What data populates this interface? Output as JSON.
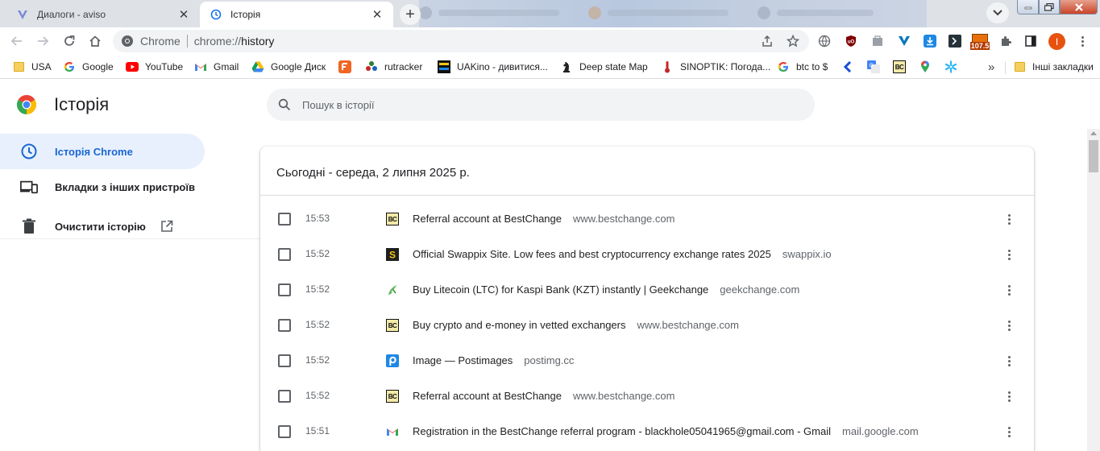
{
  "tabs": [
    {
      "title": "Диалоги - aviso",
      "state": "inactive"
    },
    {
      "title": "Історія",
      "state": "active"
    }
  ],
  "omnibox": {
    "site_label": "Chrome",
    "url_scheme": "chrome://",
    "url_path": "history"
  },
  "extension_badge": "107.5",
  "profile_initial": "I",
  "bookmarks": [
    {
      "label": "USA",
      "icon": "folder-icon"
    },
    {
      "label": "Google",
      "icon": "google-icon"
    },
    {
      "label": "YouTube",
      "icon": "youtube-icon"
    },
    {
      "label": "Gmail",
      "icon": "gmail-icon"
    },
    {
      "label": "Google Диск",
      "icon": "drive-icon"
    },
    {
      "label": "",
      "icon": "orange-app-icon"
    },
    {
      "label": "rutracker",
      "icon": "rutracker-icon"
    },
    {
      "label": "UAKino - дивитися...",
      "icon": "uakino-icon"
    },
    {
      "label": "Deep state Map",
      "icon": "knight-icon"
    },
    {
      "label": "SINOPTIK: Погода...",
      "icon": "thermometer-icon"
    },
    {
      "label": "btc to $",
      "icon": "google-icon"
    }
  ],
  "bookmarks_overflow": "»",
  "other_bookmarks": "Інші закладки",
  "page": {
    "title": "Історія",
    "search_placeholder": "Пошук в історії"
  },
  "sidebar": {
    "items": [
      {
        "label": "Історія Chrome",
        "icon": "clock-icon",
        "active": true
      },
      {
        "label": "Вкладки з інших пристроїв",
        "icon": "devices-icon",
        "active": false
      },
      {
        "label": "Очистити історію",
        "icon": "trash-icon",
        "active": false
      }
    ]
  },
  "history": {
    "date_heading": "Сьогодні - середа, 2 липня 2025 р.",
    "entries": [
      {
        "time": "15:53",
        "title": "Referral account at BestChange",
        "domain": "www.bestchange.com",
        "favicon": "bestchange-icon"
      },
      {
        "time": "15:52",
        "title": "Official Swappix Site. Low fees and best cryptocurrency exchange rates 2025",
        "domain": "swappix.io",
        "favicon": "swappix-icon"
      },
      {
        "time": "15:52",
        "title": "Buy Litecoin (LTC) for Kaspi Bank (KZT) instantly | Geekchange",
        "domain": "geekchange.com",
        "favicon": "geekchange-icon"
      },
      {
        "time": "15:52",
        "title": "Buy crypto and e-money in vetted exchangers",
        "domain": "www.bestchange.com",
        "favicon": "bestchange-icon"
      },
      {
        "time": "15:52",
        "title": "Image — Postimages",
        "domain": "postimg.cc",
        "favicon": "postimages-icon"
      },
      {
        "time": "15:52",
        "title": "Referral account at BestChange",
        "domain": "www.bestchange.com",
        "favicon": "bestchange-icon"
      },
      {
        "time": "15:51",
        "title": "Registration in the BestChange referral program - blackhole05041965@gmail.com - Gmail",
        "domain": "mail.google.com",
        "favicon": "gmail-icon"
      }
    ]
  },
  "colors": {
    "accent": "#1967d2",
    "active_bg": "#e8f0fe",
    "profile": "#e8520f"
  }
}
